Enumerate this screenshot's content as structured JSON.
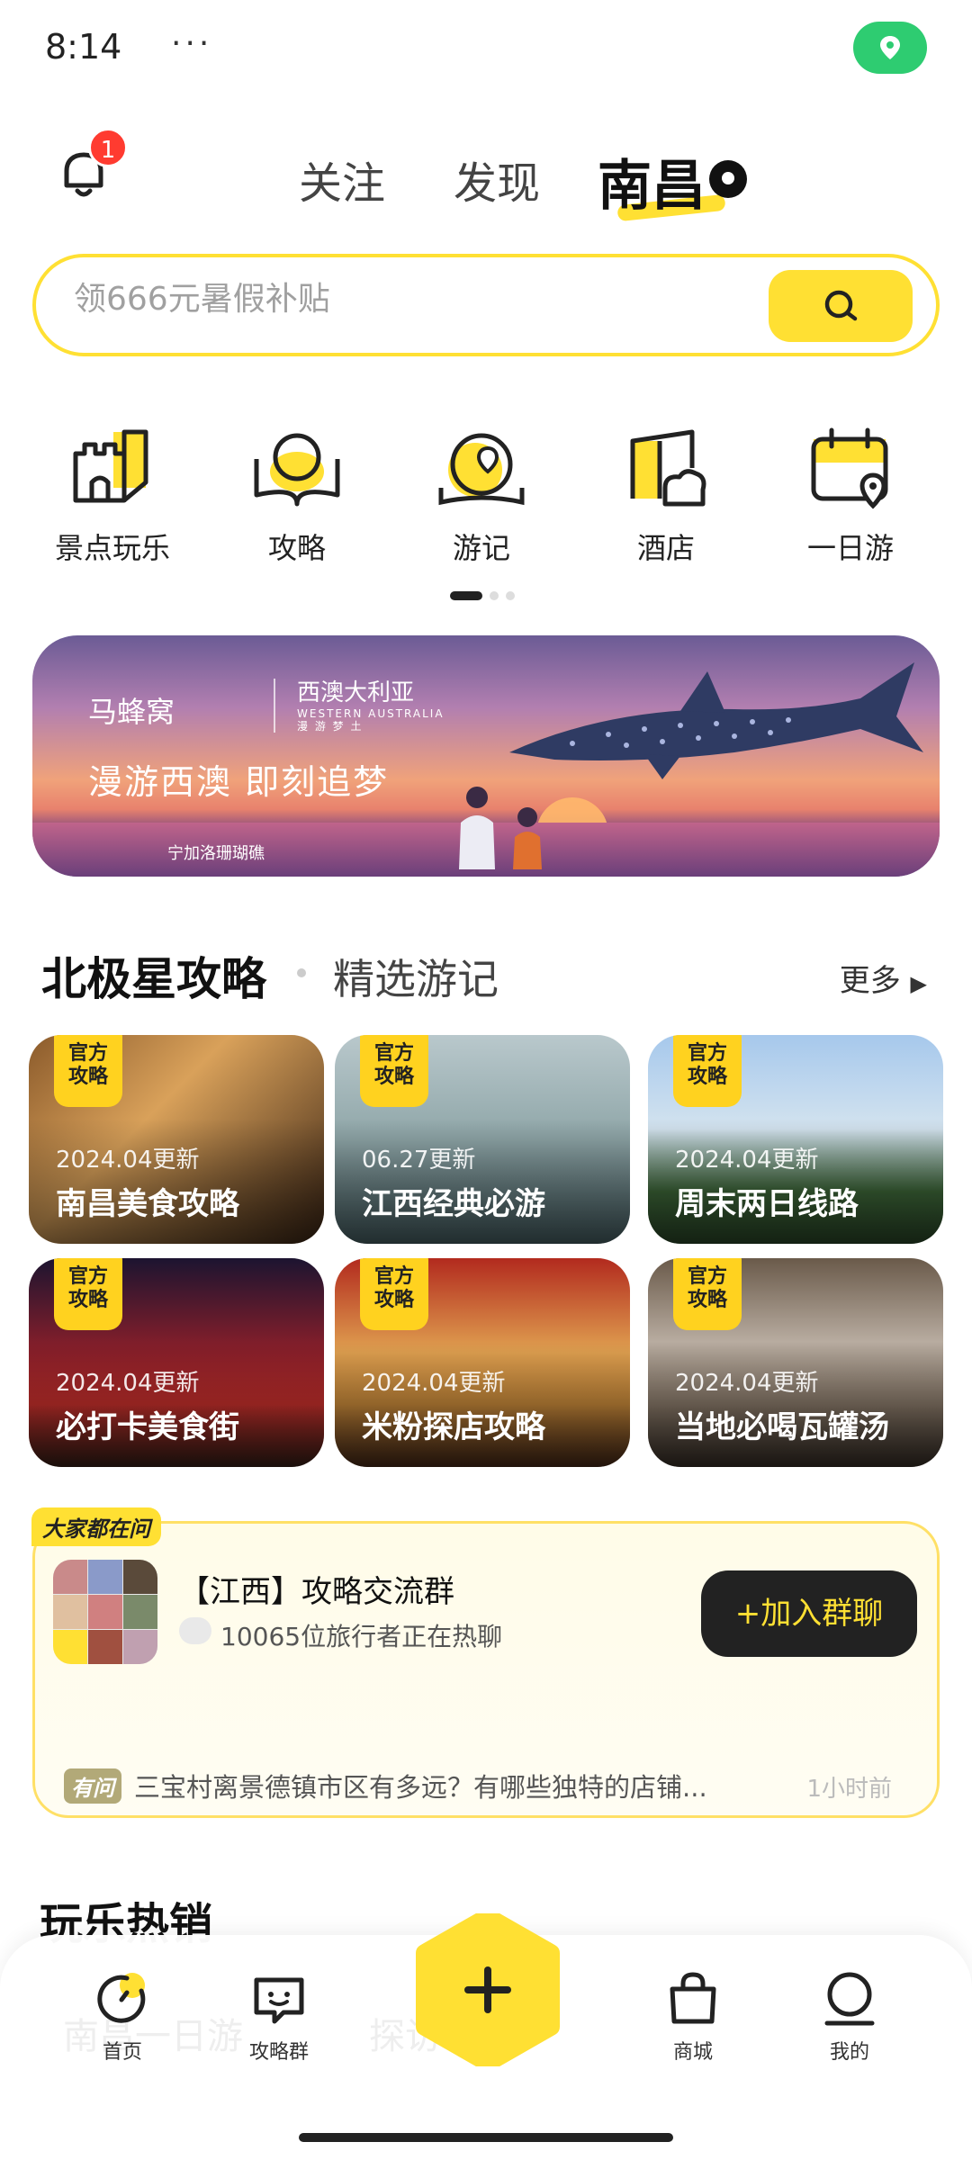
{
  "status_bar": {
    "time": "8:14",
    "more": "···"
  },
  "top_nav": {
    "notification_count": "1",
    "tabs": [
      {
        "label": "关注"
      },
      {
        "label": "发现"
      },
      {
        "label": "南昌"
      }
    ]
  },
  "search": {
    "placeholder": "领666元暑假补贴"
  },
  "categories": [
    {
      "label": "景点玩乐",
      "icon": "castle-icon"
    },
    {
      "label": "攻略",
      "icon": "guide-book-icon"
    },
    {
      "label": "游记",
      "icon": "travel-note-icon"
    },
    {
      "label": "酒店",
      "icon": "hotel-icon"
    },
    {
      "label": "一日游",
      "icon": "calendar-pin-icon"
    }
  ],
  "banner": {
    "brand": "马蜂窝",
    "partner": "西澳大利亚",
    "partner_en": "WESTERN AUSTRALIA",
    "partner_tagline": "漫 游 梦 土",
    "slogan": "漫游西澳 即刻追梦",
    "spot": "宁加洛珊瑚礁"
  },
  "section": {
    "title": "北极星攻略",
    "subtitle": "精选游记",
    "more": "更多"
  },
  "guides": [
    {
      "badge": "官方攻略",
      "date": "2024.04更新",
      "title": "南昌美食攻略"
    },
    {
      "badge": "官方攻略",
      "date": "06.27更新",
      "title": "江西经典必游"
    },
    {
      "badge": "官方攻略",
      "date": "2024.04更新",
      "title": "周末两日线路"
    },
    {
      "badge": "官方攻略",
      "date": "2024.04更新",
      "title": "必打卡美食街"
    },
    {
      "badge": "官方攻略",
      "date": "2024.04更新",
      "title": "米粉探店攻略"
    },
    {
      "badge": "官方攻略",
      "date": "2024.04更新",
      "title": "当地必喝瓦罐汤"
    }
  ],
  "group": {
    "tag": "大家都在问",
    "title": "【江西】攻略交流群",
    "subtitle": "10065位旅行者正在热聊",
    "join_label": "加入群聊",
    "question_tag": "有问",
    "question": "三宝村离景德镇市区有多远？有哪些独特的店铺...",
    "question_time": "1小时前"
  },
  "hot": {
    "title": "玩乐热销",
    "faint_items": [
      "南昌一日游",
      "探访"
    ]
  },
  "bottom_nav": [
    {
      "label": "首页"
    },
    {
      "label": "攻略群"
    },
    {
      "label": "商城"
    },
    {
      "label": "我的"
    }
  ],
  "colors": {
    "accent": "#ffe033",
    "dark": "#222222",
    "location_green": "#2ecc71"
  }
}
